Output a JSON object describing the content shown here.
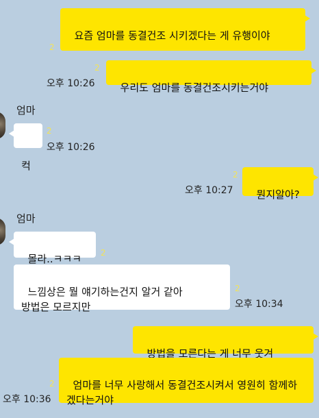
{
  "messages": [
    {
      "text": "요즘 엄마를 동결건조 시키겠다는 게 유행이야",
      "unread": "2"
    },
    {
      "text": "우리도 엄마를 동결건조시키는거야",
      "unread": "2",
      "time": "오후 10:26"
    },
    {
      "sender": "엄마",
      "text": "컥",
      "unread": "2",
      "time": "오후 10:26"
    },
    {
      "text": "뭔지알아?",
      "unread": "2",
      "time": "오후 10:27"
    },
    {
      "sender": "엄마",
      "text": "몰라..ㅋㅋㅋ",
      "unread": "2"
    },
    {
      "text": "느낌상은 뭘 얘기하는건지 알거 같아\n방법은 모르지만",
      "unread": "2",
      "time": "오후 10:34"
    },
    {
      "text": "방법을 모른다는 게 너무 웃겨"
    },
    {
      "text": "엄마를 너무 사랑해서 동결건조시켜서 영원히 함께하겠다는거야",
      "unread": "2",
      "time": "오후 10:36"
    }
  ],
  "colors": {
    "background": "#bacee0",
    "my_bubble": "#fee500",
    "their_bubble": "#ffffff"
  }
}
